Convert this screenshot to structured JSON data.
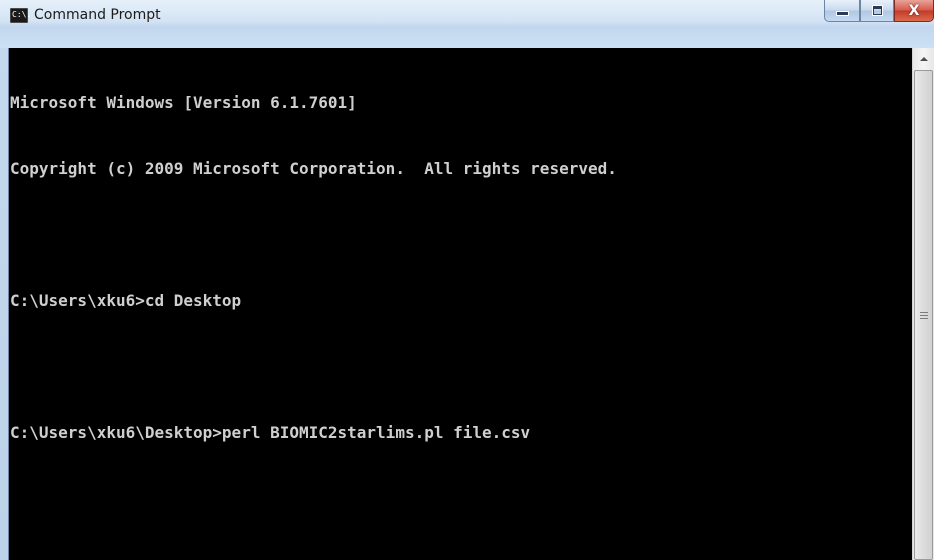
{
  "window": {
    "title": "Command Prompt",
    "icon": "cmd-icon",
    "icon_text": "C:\\."
  },
  "controls": {
    "minimize": "minimize-icon",
    "maximize": "maximize-icon",
    "close": "close-icon",
    "close_glyph": "X"
  },
  "console": {
    "lines": [
      "Microsoft Windows [Version 6.1.7601]",
      "Copyright (c) 2009 Microsoft Corporation.  All rights reserved.",
      "",
      "C:\\Users\\xku6>cd Desktop",
      "",
      "C:\\Users\\xku6\\Desktop>perl BIOMIC2starlims.pl file.csv"
    ],
    "foreground_color": "#cfcfcf",
    "background_color": "#000000"
  },
  "scrollbar": {
    "up_arrow": "scroll-up-arrow-icon",
    "grip": "grip-icon"
  }
}
